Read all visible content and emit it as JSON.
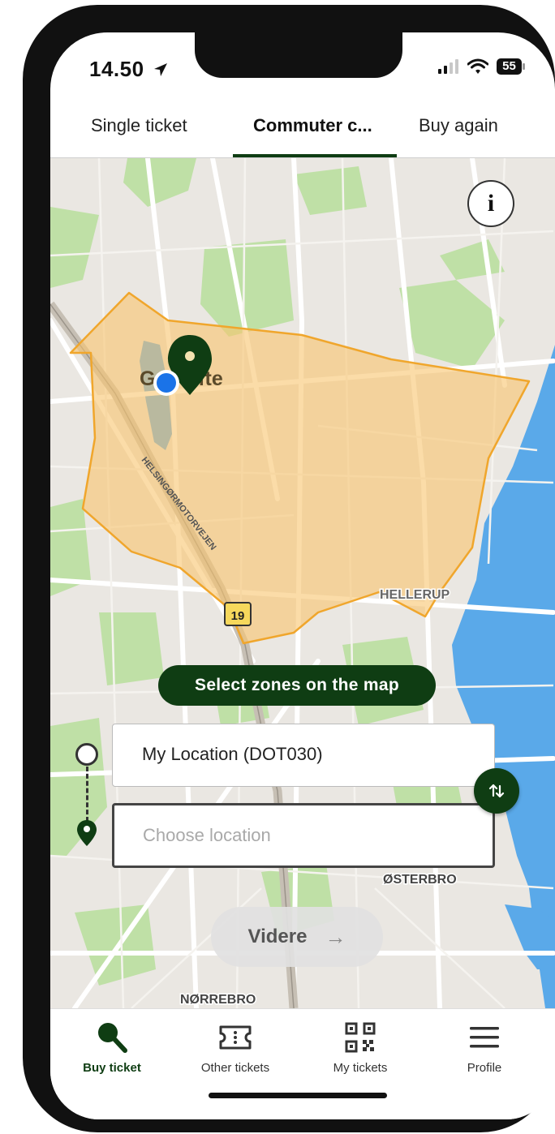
{
  "status_bar": {
    "time": "14.50",
    "battery": "55"
  },
  "top_tabs": [
    {
      "label": "Single ticket"
    },
    {
      "label": "Commuter c..."
    },
    {
      "label": "Buy again"
    }
  ],
  "map": {
    "place_labels": {
      "gentofte": "Gentofte",
      "hellerup": "HELLERUP",
      "osterbro": "ØSTERBRO",
      "norrebro": "NØRREBRO"
    },
    "road_label": "HELSINGØRMOTORVEJEN",
    "route_shield": "19",
    "info_symbol": "i"
  },
  "select_zones_label": "Select zones on the map",
  "from_field": {
    "value": "My Location (DOT030)"
  },
  "to_field": {
    "placeholder": "Choose location"
  },
  "next_button": {
    "label": "Videre",
    "arrow": "→"
  },
  "bottom_nav": [
    {
      "label": "Buy ticket",
      "icon": "search-icon",
      "active": true
    },
    {
      "label": "Other tickets",
      "icon": "ticket-icon",
      "active": false
    },
    {
      "label": "My tickets",
      "icon": "qr-code-icon",
      "active": false
    },
    {
      "label": "Profile",
      "icon": "menu-icon",
      "active": false
    }
  ],
  "colors": {
    "brand": "#0f3d13",
    "zone_fill": "#f9cf85",
    "zone_stroke": "#f0a62c",
    "water": "#5aa9e9",
    "park": "#bfe0a6",
    "location_dot": "#1a73e8"
  }
}
